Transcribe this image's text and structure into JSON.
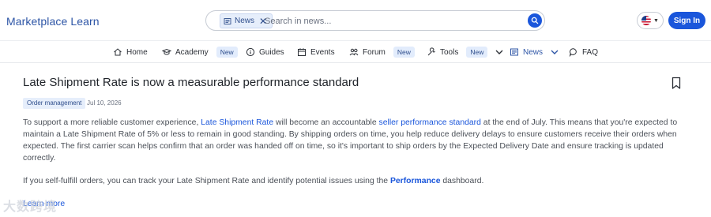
{
  "header": {
    "brand": "Marketplace Learn",
    "search": {
      "chip_label": "News",
      "chip_close": "✕",
      "placeholder": "Search in news..."
    },
    "sign_in": "Sign In"
  },
  "nav": {
    "items": [
      {
        "label": "Home",
        "icon": "home-icon"
      },
      {
        "label": "Academy",
        "icon": "graduation-cap-icon",
        "badge": "New"
      },
      {
        "label": "Guides",
        "icon": "info-circle-icon"
      },
      {
        "label": "Events",
        "icon": "calendar-icon"
      },
      {
        "label": "Forum",
        "icon": "people-icon",
        "badge": "New"
      },
      {
        "label": "Tools",
        "icon": "wrench-icon",
        "badge": "New",
        "dropdown": true
      },
      {
        "label": "News",
        "icon": "news-icon",
        "dropdown": true,
        "active": true
      },
      {
        "label": "FAQ",
        "icon": "chat-bubble-icon"
      }
    ]
  },
  "article": {
    "title": "Late Shipment Rate is now a measurable performance standard",
    "tag": "Order management",
    "date": "Jul 10, 2026",
    "p1": {
      "t1": "To support a more reliable customer experience, ",
      "link1": "Late Shipment Rate",
      "t2": " will become an accountable ",
      "link2": "seller performance standard",
      "t3": " at the end of July. This means that you're expected to maintain a Late Shipment Rate of 5% or less  to remain in good standing. By shipping orders on time, you help reduce delivery delays to ensure customers receive their orders when expected. The first carrier scan helps confirm that an order was handed off on time, so it's important to ship orders by the Expected Delivery Date and ensure tracking is updated correctly."
    },
    "p2": {
      "t1": "If you self-fulfill orders, you can track your Late Shipment Rate and identify potential issues using the ",
      "link": "Performance",
      "t2": " dashboard."
    },
    "learn_more": "Learn more"
  },
  "watermark": "大数跨境",
  "colors": {
    "accent": "#1a56db",
    "brand": "#2d55a6",
    "badge_bg": "#e2ecfc",
    "text": "#4b5058"
  }
}
